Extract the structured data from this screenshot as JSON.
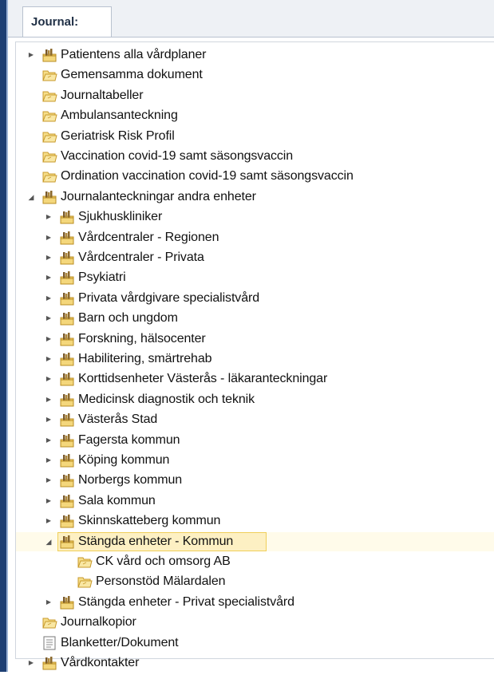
{
  "tab": {
    "label": "Journal:"
  },
  "tree": [
    {
      "label": "Patientens alla vårdplaner",
      "icon": "folder-books-icon",
      "expander": "collapsed",
      "level": 0
    },
    {
      "label": "Gemensamma dokument",
      "icon": "folder-icon",
      "expander": "none",
      "level": 0
    },
    {
      "label": "Journaltabeller",
      "icon": "folder-icon",
      "expander": "none",
      "level": 0
    },
    {
      "label": "Ambulansanteckning",
      "icon": "folder-icon",
      "expander": "none",
      "level": 0
    },
    {
      "label": "Geriatrisk Risk Profil",
      "icon": "folder-icon",
      "expander": "none",
      "level": 0
    },
    {
      "label": "Vaccination covid-19 samt säsongsvaccin",
      "icon": "folder-icon",
      "expander": "none",
      "level": 0
    },
    {
      "label": "Ordination vaccination covid-19 samt säsongsvaccin",
      "icon": "folder-icon",
      "expander": "none",
      "level": 0
    },
    {
      "label": "Journalanteckningar andra enheter",
      "icon": "folder-books-icon",
      "expander": "expanded",
      "level": 0
    },
    {
      "label": "Sjukhuskliniker",
      "icon": "folder-books-icon",
      "expander": "collapsed",
      "level": 1
    },
    {
      "label": "Vårdcentraler - Regionen",
      "icon": "folder-books-icon",
      "expander": "collapsed",
      "level": 1
    },
    {
      "label": "Vårdcentraler - Privata",
      "icon": "folder-books-icon",
      "expander": "collapsed",
      "level": 1
    },
    {
      "label": "Psykiatri",
      "icon": "folder-books-icon",
      "expander": "collapsed",
      "level": 1
    },
    {
      "label": "Privata vårdgivare specialistvård",
      "icon": "folder-books-icon",
      "expander": "collapsed",
      "level": 1
    },
    {
      "label": "Barn och ungdom",
      "icon": "folder-books-icon",
      "expander": "collapsed",
      "level": 1
    },
    {
      "label": "Forskning, hälsocenter",
      "icon": "folder-books-icon",
      "expander": "collapsed",
      "level": 1
    },
    {
      "label": "Habilitering, smärtrehab",
      "icon": "folder-books-icon",
      "expander": "collapsed",
      "level": 1
    },
    {
      "label": "Korttidsenheter Västerås - läkaranteckningar",
      "icon": "folder-books-icon",
      "expander": "collapsed",
      "level": 1
    },
    {
      "label": "Medicinsk diagnostik och teknik",
      "icon": "folder-books-icon",
      "expander": "collapsed",
      "level": 1
    },
    {
      "label": "Västerås Stad",
      "icon": "folder-books-icon",
      "expander": "collapsed",
      "level": 1
    },
    {
      "label": "Fagersta kommun",
      "icon": "folder-books-icon",
      "expander": "collapsed",
      "level": 1
    },
    {
      "label": "Köping kommun",
      "icon": "folder-books-icon",
      "expander": "collapsed",
      "level": 1
    },
    {
      "label": "Norbergs kommun",
      "icon": "folder-books-icon",
      "expander": "collapsed",
      "level": 1
    },
    {
      "label": "Sala kommun",
      "icon": "folder-books-icon",
      "expander": "collapsed",
      "level": 1
    },
    {
      "label": "Skinnskatteberg kommun",
      "icon": "folder-books-icon",
      "expander": "collapsed",
      "level": 1
    },
    {
      "label": "Stängda enheter - Kommun",
      "icon": "folder-books-icon",
      "expander": "expanded",
      "level": 1,
      "selected": true
    },
    {
      "label": "CK vård och omsorg AB",
      "icon": "folder-icon",
      "expander": "none",
      "level": 2
    },
    {
      "label": "Personstöd Mälardalen",
      "icon": "folder-icon",
      "expander": "none",
      "level": 2
    },
    {
      "label": "Stängda enheter - Privat specialistvård",
      "icon": "folder-books-icon",
      "expander": "collapsed",
      "level": 1
    },
    {
      "label": "Journalkopior",
      "icon": "folder-icon",
      "expander": "none",
      "level": 0
    },
    {
      "label": "Blanketter/Dokument",
      "icon": "document-icon",
      "expander": "none",
      "level": 0
    },
    {
      "label": "Vårdkontakter",
      "icon": "folder-books-icon",
      "expander": "collapsed",
      "level": 0
    }
  ],
  "colors": {
    "selection_fill": "#fdf0c3",
    "selection_border": "#f0cf5a",
    "folder_yellow": "#f3d36b",
    "window_accent": "#1d3f73"
  }
}
